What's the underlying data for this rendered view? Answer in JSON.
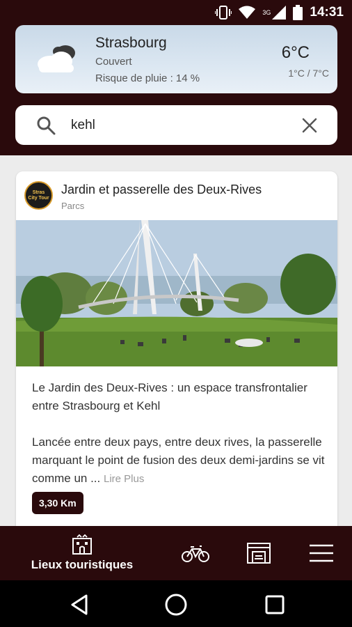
{
  "status_bar": {
    "time": "14:31",
    "network": "3G"
  },
  "weather": {
    "city": "Strasbourg",
    "condition": "Couvert",
    "rain_risk": "Risque de pluie : 14 %",
    "temperature": "6°C",
    "range": "1°C / 7°C",
    "icon": "cloudy-icon"
  },
  "search": {
    "value": "kehl",
    "placeholder": ""
  },
  "card": {
    "logo_lines": [
      "Stras",
      "City Tour"
    ],
    "title": "Jardin et passerelle des Deux-Rives",
    "category": "Parcs",
    "headline": "Le Jardin des Deux-Rives : un espace transfrontalier entre Strasbourg et Kehl",
    "body": "Lancée entre deux pays, entre deux rives, la passerelle marquant le point de fusion des deux demi-jardins se vit comme un ...",
    "read_more": "Lire Plus",
    "distance": "3,30 Km"
  },
  "bottom_nav": {
    "items": [
      {
        "label": "Lieux touristiques",
        "icon": "landmark-icon"
      },
      {
        "label": "",
        "icon": "bicycle-icon"
      },
      {
        "label": "",
        "icon": "parking-garage-icon"
      },
      {
        "label": "",
        "icon": "menu-icon"
      }
    ]
  },
  "colors": {
    "brand": "#2a0a0c",
    "background": "#ececec"
  }
}
